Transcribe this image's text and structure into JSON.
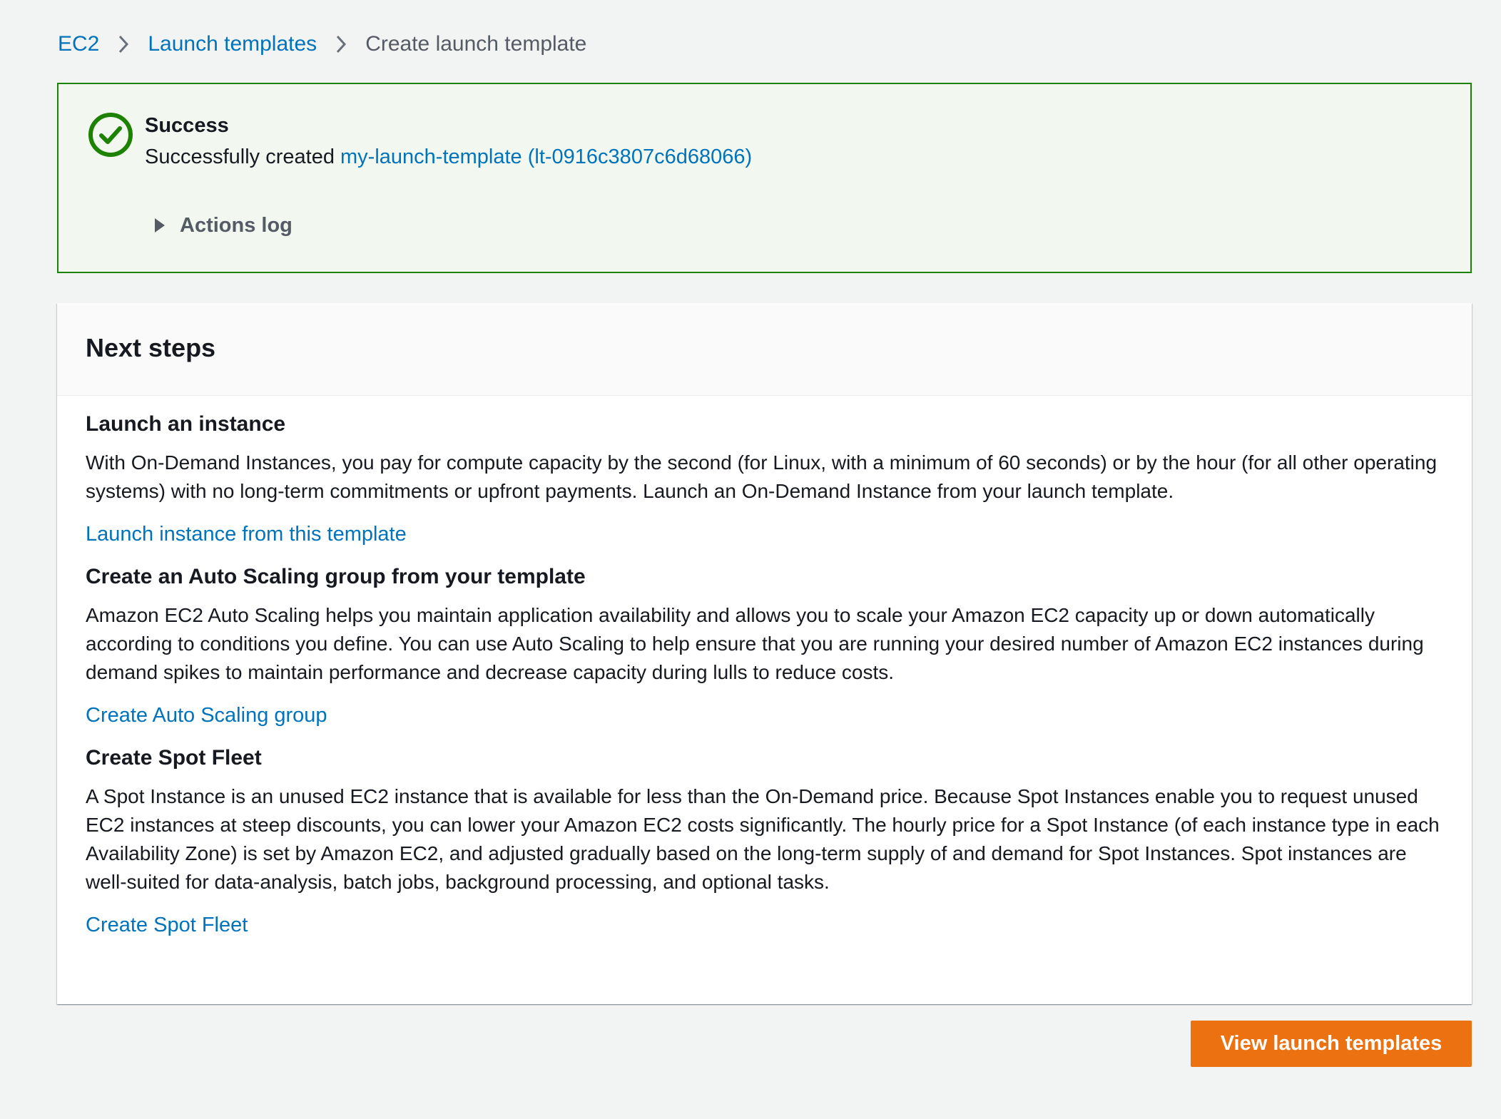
{
  "breadcrumb": {
    "items": [
      {
        "label": "EC2"
      },
      {
        "label": "Launch templates"
      },
      {
        "label": "Create launch template"
      }
    ]
  },
  "flash": {
    "title": "Success",
    "message_prefix": "Successfully created ",
    "link_text": "my-launch-template (lt-0916c3807c6d68066)",
    "actions_log_label": "Actions log",
    "icon": "check-circle-icon"
  },
  "next_steps": {
    "title": "Next steps",
    "sections": [
      {
        "title": "Launch an instance",
        "text": "With On-Demand Instances, you pay for compute capacity by the second (for Linux, with a minimum of 60 seconds) or by the hour (for all other operating systems) with no long-term commitments or upfront payments. Launch an On-Demand Instance from your launch template.",
        "link": "Launch instance from this template"
      },
      {
        "title": "Create an Auto Scaling group from your template",
        "text": "Amazon EC2 Auto Scaling helps you maintain application availability and allows you to scale your Amazon EC2 capacity up or down automatically according to conditions you define. You can use Auto Scaling to help ensure that you are running your desired number of Amazon EC2 instances during demand spikes to maintain performance and decrease capacity during lulls to reduce costs.",
        "link": "Create Auto Scaling group"
      },
      {
        "title": "Create Spot Fleet",
        "text": "A Spot Instance is an unused EC2 instance that is available for less than the On-Demand price. Because Spot Instances enable you to request unused EC2 instances at steep discounts, you can lower your Amazon EC2 costs significantly. The hourly price for a Spot Instance (of each instance type in each Availability Zone) is set by Amazon EC2, and adjusted gradually based on the long-term supply of and demand for Spot Instances. Spot instances are well-suited for data-analysis, batch jobs, background processing, and optional tasks.",
        "link": "Create Spot Fleet"
      }
    ]
  },
  "primary_button": {
    "label": "View launch templates"
  },
  "colors": {
    "link": "#0073bb",
    "success": "#1d8102",
    "success_bg": "#f2f8f0",
    "primary": "#ec7211",
    "page_bg": "#f2f3f3"
  }
}
